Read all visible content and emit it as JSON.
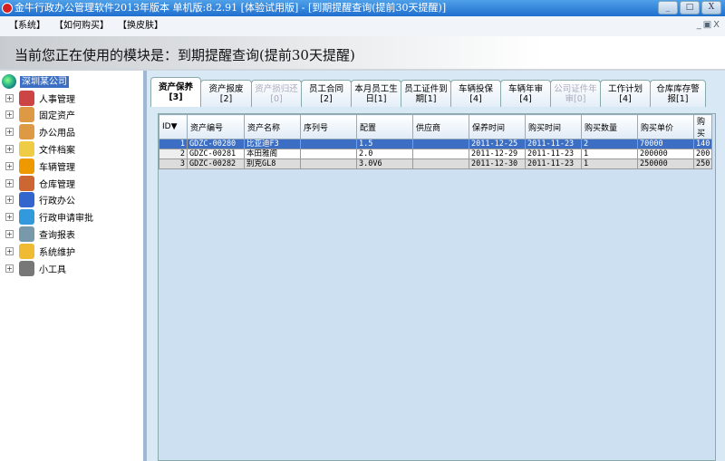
{
  "window": {
    "title": "金牛行政办公管理软件2013年版本 单机版:8.2.91 [体验试用版] - [到期提醒查询(提前30天提醒)]",
    "buttons": [
      "_",
      "□",
      "X"
    ]
  },
  "menu": [
    "【系统】",
    "【如何购买】",
    "【换皮肤】"
  ],
  "mdi_controls": "_▣X",
  "banner": "当前您正在使用的模块是：到期提醒查询(提前30天提醒)",
  "tree": {
    "root": "深圳某公司",
    "items": [
      {
        "label": "人事管理",
        "color": "#c44"
      },
      {
        "label": "固定资产",
        "color": "#d94"
      },
      {
        "label": "办公用品",
        "color": "#d94"
      },
      {
        "label": "文件档案",
        "color": "#ec4"
      },
      {
        "label": "车辆管理",
        "color": "#e90"
      },
      {
        "label": "仓库管理",
        "color": "#c63"
      },
      {
        "label": "行政办公",
        "color": "#36c"
      },
      {
        "label": "行政申请审批",
        "color": "#39d"
      },
      {
        "label": "查询报表",
        "color": "#79a"
      },
      {
        "label": "系统维护",
        "color": "#eb3"
      },
      {
        "label": "小工具",
        "color": "#777"
      }
    ]
  },
  "tabs": [
    {
      "label": "资产保养[3]",
      "active": true
    },
    {
      "label": "资产报废[2]"
    },
    {
      "label": "资产损归还[0]",
      "disabled": true
    },
    {
      "label": "员工合同[2]"
    },
    {
      "label": "本月员工生日[1]"
    },
    {
      "label": "员工证件到期[1]"
    },
    {
      "label": "车辆投保[4]"
    },
    {
      "label": "车辆年审[4]"
    },
    {
      "label": "公司证件年审[0]",
      "disabled": true
    },
    {
      "label": "工作计划[4]"
    },
    {
      "label": "仓库库存警报[1]"
    }
  ],
  "table": {
    "columns": [
      "ID▼",
      "资产编号",
      "资产名称",
      "序列号",
      "配置",
      "供应商",
      "保养时间",
      "购买时间",
      "购买数量",
      "购买单价",
      "购买"
    ],
    "rows": [
      [
        "1",
        "GDZC-00280",
        "比亚迪F3",
        "",
        "1.5",
        "",
        "2011-12-25",
        "2011-11-23",
        "2",
        "70000",
        "140"
      ],
      [
        "2",
        "GDZC-00281",
        "本田雅阁",
        "",
        "2.0",
        "",
        "2011-12-29",
        "2011-11-23",
        "1",
        "200000",
        "200"
      ],
      [
        "3",
        "GDZC-00282",
        "别克GL8",
        "",
        "3.0V6",
        "",
        "2011-12-30",
        "2011-11-23",
        "1",
        "250000",
        "250"
      ]
    ]
  }
}
